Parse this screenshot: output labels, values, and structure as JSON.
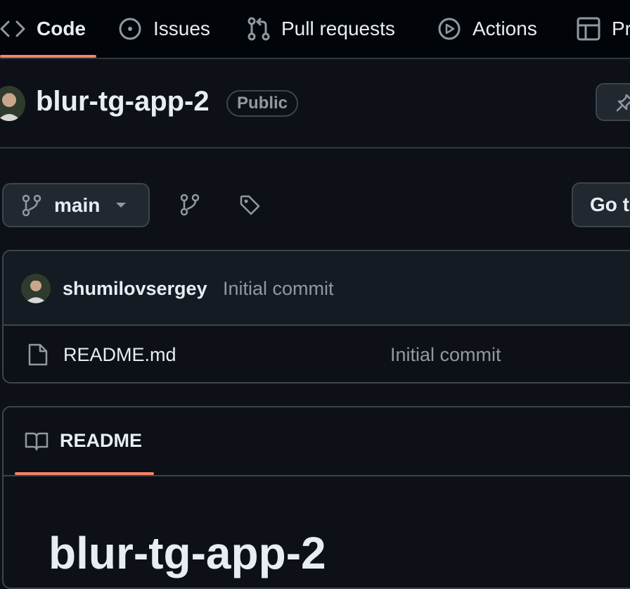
{
  "nav": {
    "tabs": [
      {
        "label": "Code",
        "icon": "code-icon",
        "selected": true
      },
      {
        "label": "Issues",
        "icon": "issue-opened-icon"
      },
      {
        "label": "Pull requests",
        "icon": "git-pull-request-icon"
      },
      {
        "label": "Actions",
        "icon": "play-icon"
      },
      {
        "label": "Pr",
        "icon": "table-icon"
      }
    ]
  },
  "repo": {
    "name": "blur-tg-app-2",
    "visibility": "Public"
  },
  "branch": {
    "current": "main",
    "goto_label": "Go t"
  },
  "latest_commit": {
    "author": "shumilovsergey",
    "message": "Initial commit"
  },
  "files": [
    {
      "name": "README.md",
      "commit_message": "Initial commit",
      "icon": "file-icon"
    }
  ],
  "readme": {
    "tab_label": "README",
    "heading": "blur-tg-app-2"
  },
  "colors": {
    "background": "#0d1117",
    "accent_underline": "#f78166",
    "border": "#3d444d",
    "muted_text": "#9198a1"
  }
}
